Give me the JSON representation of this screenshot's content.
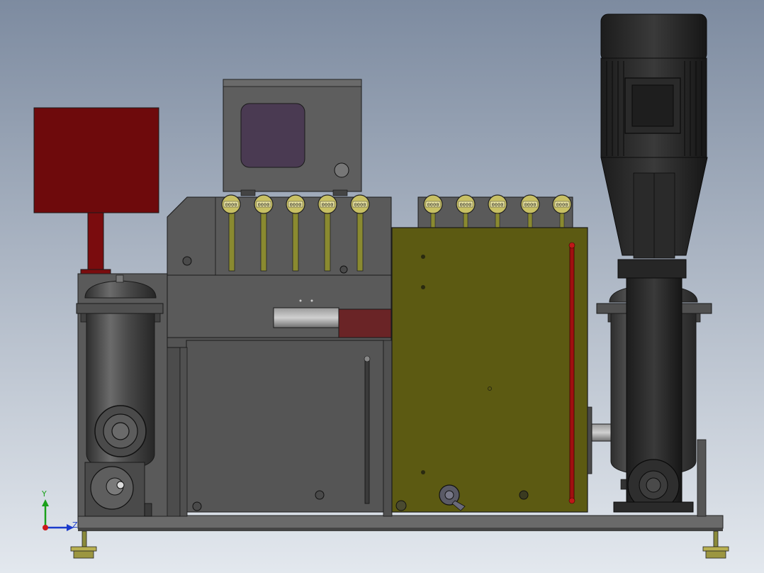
{
  "axis_triad": {
    "y_label": "Y",
    "x_label": "Z"
  },
  "gauges": {
    "left_bank": [
      "0000",
      "0000",
      "0000",
      "0000",
      "0000"
    ],
    "right_bank": [
      "0000",
      "0000",
      "0000",
      "0000",
      "0000"
    ]
  },
  "colors": {
    "background_top": "#7d8ba0",
    "background_bottom": "#e3e8ee",
    "maroon_box": "#6e0a0c",
    "olive_tank": "#5c5a12",
    "steel_dark": "#3a3a3a",
    "steel_mid": "#5a5a5a",
    "gauge_face": "#c8c064",
    "sight_glass_red": "#a01010"
  }
}
